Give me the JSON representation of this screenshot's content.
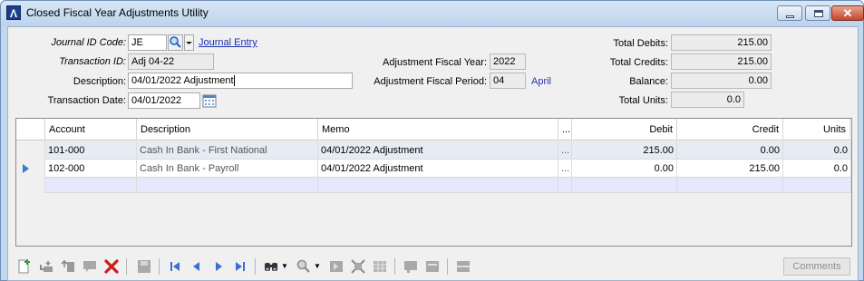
{
  "window": {
    "title": "Closed Fiscal Year Adjustments Utility",
    "app_icon_letter": "Λ"
  },
  "form": {
    "journal_id": {
      "label": "Journal ID Code:",
      "value": "JE",
      "link": "Journal Entry"
    },
    "transaction_id": {
      "label": "Transaction ID:",
      "value": "Adj 04-22"
    },
    "description": {
      "label": "Description:",
      "value": "04/01/2022 Adjustment"
    },
    "transaction_date": {
      "label": "Transaction Date:",
      "value": "04/01/2022"
    },
    "fiscal_year": {
      "label": "Adjustment Fiscal Year:",
      "value": "2022"
    },
    "fiscal_period": {
      "label": "Adjustment Fiscal Period:",
      "value": "04",
      "month": "April"
    }
  },
  "totals": {
    "debits": {
      "label": "Total Debits:",
      "value": "215.00"
    },
    "credits": {
      "label": "Total Credits:",
      "value": "215.00"
    },
    "balance": {
      "label": "Balance:",
      "value": "0.00"
    },
    "units": {
      "label": "Total Units:",
      "value": "0.0"
    }
  },
  "grid": {
    "headers": {
      "account": "Account",
      "description": "Description",
      "memo": "Memo",
      "ellipsis": "...",
      "debit": "Debit",
      "credit": "Credit",
      "units": "Units"
    },
    "rows": [
      {
        "account": "101-000",
        "description": "Cash In Bank - First National",
        "memo": "04/01/2022 Adjustment",
        "ellipsis": "...",
        "debit": "215.00",
        "credit": "0.00",
        "units": "0.0"
      },
      {
        "account": "102-000",
        "description": "Cash In Bank - Payroll",
        "memo": "04/01/2022 Adjustment",
        "ellipsis": "...",
        "debit": "0.00",
        "credit": "215.00",
        "units": "0.0"
      }
    ]
  },
  "toolbar": {
    "comments_label": "Comments"
  },
  "colors": {
    "row_selected": "#e6ecf4",
    "row_new": "#e7e8fb",
    "link": "#1b2fb0",
    "delete": "#d11a1a",
    "nav": "#3b6fd6"
  }
}
